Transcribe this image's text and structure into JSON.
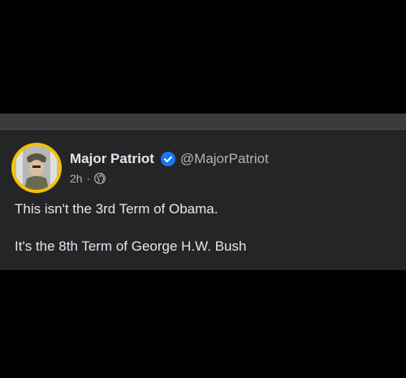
{
  "post": {
    "author_name": "Major Patriot",
    "handle": "@MajorPatriot",
    "timestamp": "2h",
    "separator": "·",
    "audience_icon": "globe-icon",
    "verified_icon": "verified-badge-icon",
    "text_lines": [
      "This isn't the 3rd Term of Obama.",
      "It's the 8th Term of George H.W. Bush"
    ]
  },
  "colors": {
    "background": "#000000",
    "card": "#242526",
    "strip": "#3a3b3c",
    "primary_text": "#e4e6eb",
    "secondary_text": "#b0b3b8",
    "verified_blue": "#1877f2",
    "avatar_ring": "#f2c200"
  }
}
